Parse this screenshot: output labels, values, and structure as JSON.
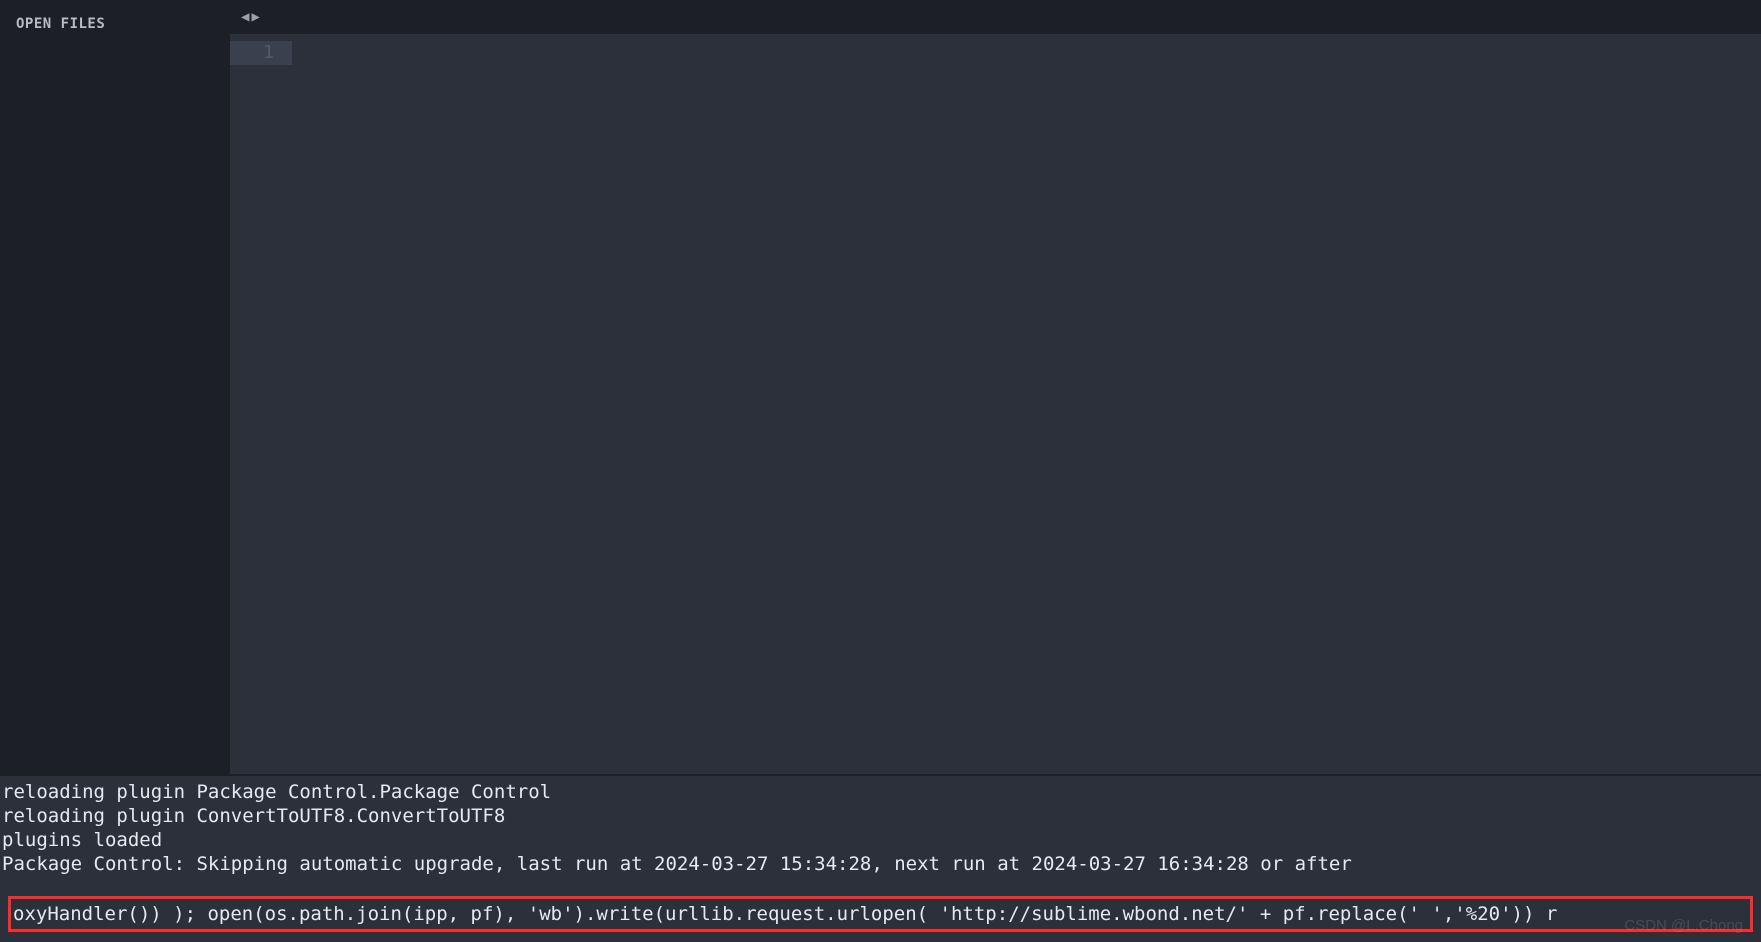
{
  "sidebar": {
    "header_label": "OPEN FILES"
  },
  "tabbar": {
    "prev_glyph": "◀",
    "next_glyph": "▶"
  },
  "editor": {
    "line_numbers": [
      "1"
    ],
    "content": ""
  },
  "console": {
    "lines": [
      "reloading plugin Package Control.Package Control",
      "reloading plugin ConvertToUTF8.ConvertToUTF8",
      "plugins loaded",
      "Package Control: Skipping automatic upgrade, last run at 2024-03-27 15:34:28, next run at 2024-03-27 16:34:28 or after"
    ],
    "input_value": "oxyHandler()) ); open(os.path.join(ipp, pf), 'wb').write(urllib.request.urlopen( 'http://sublime.wbond.net/' + pf.replace(' ','%20')) r"
  },
  "watermark": "CSDN @L.Chong"
}
